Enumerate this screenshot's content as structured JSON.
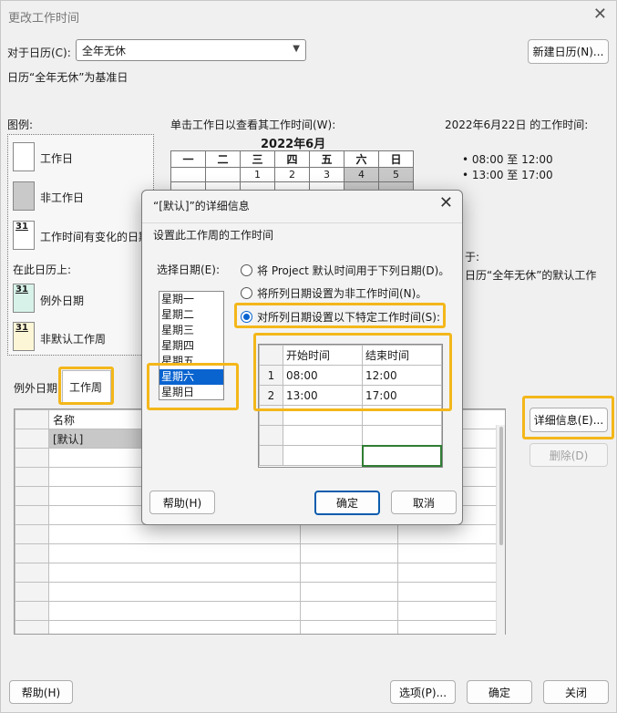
{
  "window": {
    "title": "更改工作时间",
    "close_glyph": "✕"
  },
  "for_calendar": {
    "label": "对于日历(C):",
    "value": "全年无休",
    "new_button": "新建日历(N)..."
  },
  "base_text": "日历“全年无休”为基准日",
  "legend": {
    "title": "图例:",
    "work_day": "工作日",
    "non_work_day": "非工作日",
    "changed_hours": "工作时间有变化的日期",
    "changed_num": "31",
    "on_this_calendar": "在此日历上:",
    "exception_day": "例外日期",
    "exception_num": "31",
    "nondefault_week": "非默认工作周",
    "nondefault_num": "31"
  },
  "calendar": {
    "instruction": "单击工作日以查看其工作时间(W):",
    "month": "2022年6月",
    "weekdays": [
      "一",
      "二",
      "三",
      "四",
      "五",
      "六",
      "日"
    ],
    "first_week": [
      "",
      "",
      "1",
      "2",
      "3",
      "4",
      "5"
    ]
  },
  "work_hours": {
    "title": "2022年6月22日 的工作时间:",
    "items": [
      "• 08:00 至 12:00",
      "• 13:00 至 17:00"
    ],
    "based_on_tail": "于:",
    "based_on_text": "日历“全年无休”的默认工作"
  },
  "tabs": {
    "exceptions": "例外日期",
    "work_weeks": "工作周"
  },
  "week_grid": {
    "header": "名称",
    "rows": [
      "[默认]"
    ]
  },
  "side_buttons": {
    "details": "详细信息(E)...",
    "delete": "删除(D)"
  },
  "footer": {
    "help": "帮助(H)",
    "options": "选项(P)...",
    "ok": "确定",
    "close": "关闭"
  },
  "dialog": {
    "title": "“[默认]”的详细信息",
    "close_glyph": "✕",
    "section": "设置此工作周的工作时间",
    "select_days_label": "选择日期(E):",
    "days": [
      "星期一",
      "星期二",
      "星期三",
      "星期四",
      "星期五",
      "星期六",
      "星期日"
    ],
    "selected_day": "星期六",
    "radio1": "将 Project 默认时间用于下列日期(D)。",
    "radio2": "将所列日期设置为非工作时间(N)。",
    "radio3": "对所列日期设置以下特定工作时间(S):",
    "col_start": "开始时间",
    "col_end": "结束时间",
    "times": [
      {
        "row": "1",
        "start": "08:00",
        "end": "12:00"
      },
      {
        "row": "2",
        "start": "13:00",
        "end": "17:00"
      }
    ],
    "help": "帮助(H)",
    "ok": "确定",
    "cancel": "取消"
  }
}
